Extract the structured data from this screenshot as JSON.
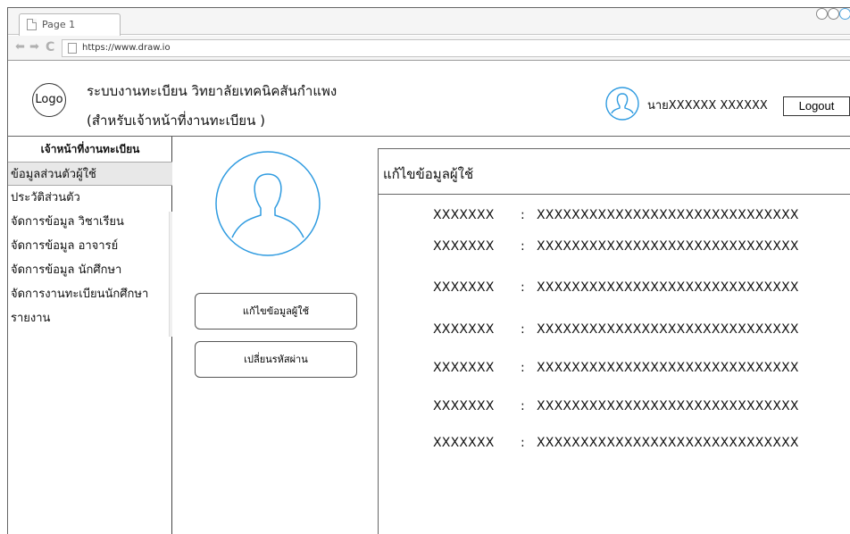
{
  "browser": {
    "tab_title": "Page 1",
    "url": "https://www.draw.io"
  },
  "header": {
    "logo": "Logo",
    "system_title": "ระบบงานทะเบียน วิทยาลัยเทคนิคสันกำแพง",
    "system_subtitle": "(สำหรับเจ้าหน้าที่งานทะเบียน )",
    "user_name": "นายXXXXXX XXXXXX",
    "logout_label": "Logout"
  },
  "sidebar": {
    "heading": "เจ้าหน้าที่งานทะเบียน",
    "items": [
      {
        "label": "ข้อมูลส่วนตัวผู้ใช้",
        "active": true
      },
      {
        "label": "ประวัติส่วนตัว"
      },
      {
        "label": "จัดการข้อมูล วิชาเรียน"
      },
      {
        "label": "จัดการข้อมูล อาจารย์"
      },
      {
        "label": "จัดการข้อมูล นักศึกษา"
      },
      {
        "label": "จัดการงานทะเบียนนักศึกษา"
      },
      {
        "label": "รายงาน"
      }
    ]
  },
  "profile": {
    "edit_button": "แก้ไขข้อมูลผู้ใช้",
    "change_password_button": "เปลี่ยนรหัสผ่าน"
  },
  "panel": {
    "title": "แก้ไขข้อมูลผู้ใช้",
    "separator": ":",
    "fields": [
      {
        "label": "XXXXXXX",
        "value": "XXXXXXXXXXXXXXXXXXXXXXXXXXXXXX"
      },
      {
        "label": "XXXXXXX",
        "value": "XXXXXXXXXXXXXXXXXXXXXXXXXXXXXX"
      },
      {
        "label": "XXXXXXX",
        "value": "XXXXXXXXXXXXXXXXXXXXXXXXXXXXXX"
      },
      {
        "label": "XXXXXXX",
        "value": "XXXXXXXXXXXXXXXXXXXXXXXXXXXXXX"
      },
      {
        "label": "XXXXXXX",
        "value": "XXXXXXXXXXXXXXXXXXXXXXXXXXXXXX"
      },
      {
        "label": "XXXXXXX",
        "value": "XXXXXXXXXXXXXXXXXXXXXXXXXXXXXX"
      },
      {
        "label": "XXXXXXX",
        "value": "XXXXXXXXXXXXXXXXXXXXXXXXXXXXXX"
      }
    ]
  },
  "colors": {
    "accent": "#2f9be0",
    "active_item_bg": "#e8e8e8",
    "border": "#666666"
  },
  "icons": [
    "page-icon",
    "back-arrow-icon",
    "forward-arrow-icon",
    "reload-icon",
    "user-avatar-icon"
  ]
}
